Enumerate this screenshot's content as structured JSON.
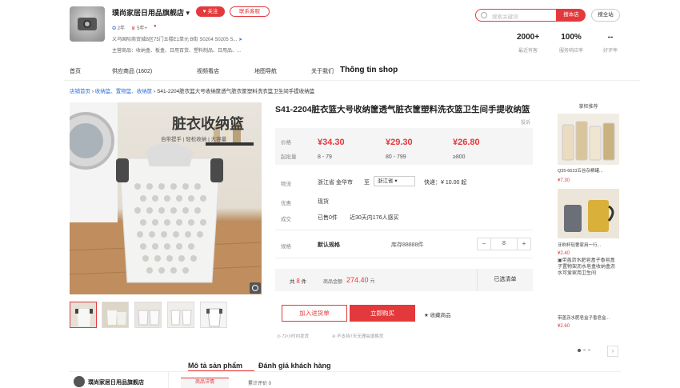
{
  "shop": {
    "name": "璞尚家居日用品旗舰店",
    "arrow": "▾",
    "follow_label": "♥ 关注",
    "contact_label": "联系客服",
    "badges": [
      "2年",
      "5年+",
      ""
    ],
    "address": "义乌国际商贸城B区75门五楼E1单元 B街 S0204 S0205 S...",
    "main_products": "主营商品：收纳盒、板盒、日用百货、塑料制品、日用品、..."
  },
  "search": {
    "placeholder": "搜索关键词",
    "search_shop_label": "搜本店",
    "search_all_label": "搜全站"
  },
  "stats": [
    {
      "value": "2000+",
      "label": "最近有客"
    },
    {
      "value": "100%",
      "label": "服务响应率"
    },
    {
      "value": "--",
      "label": "好评率"
    }
  ],
  "nav": {
    "items": [
      "首页",
      "供应商品 (1602)",
      "视频看店",
      "地图导航",
      "关于我们"
    ],
    "shop_info": "Thông tin shop"
  },
  "breadcrumb": {
    "home": "店铺首页",
    "sep": "›",
    "category": "收纳篮、置物篮、收纳筐",
    "current": "S41-2204脏衣篮大号收纳筐透气脏衣筐塑料洗衣篮卫生间手提收纳篮"
  },
  "gallery": {
    "banner_title": "脏衣收纳篮",
    "banner_sub": "自带提手 | 轻松收纳 | 大容量"
  },
  "product": {
    "title": "S41-2204脏衣篮大号收纳筐透气脏衣筐塑料洗衣篮卫生间手提收纳篮",
    "report": "投诉",
    "price_label": "价格",
    "moq_label": "起批量",
    "tiers": [
      {
        "price": "¥34.30",
        "qty": "8 - 79"
      },
      {
        "price": "¥29.30",
        "qty": "80 - 799"
      },
      {
        "price": "¥26.80",
        "qty": "≥800"
      }
    ],
    "shipping_label": "物流",
    "ship_from": "浙江省 金华市",
    "ship_to_word": "至",
    "ship_to": "浙江省",
    "ship_fee": "快递：¥ 10.00 起",
    "service_label": "优惠",
    "service_value": "现货",
    "deal_label": "成交",
    "deal_value_1": "已售0件",
    "deal_value_2": "近30天内176人感买",
    "spec_label": "规格",
    "spec_value": "默认规格",
    "stock": "库存88888件",
    "quantity": "8",
    "minus": "−",
    "plus": "+",
    "total_pre": "共",
    "total_count": "8",
    "total_unit": "件",
    "amount_label": "商品金额",
    "amount": "274.40",
    "amount_unit": "元",
    "selected_label": "已选清单",
    "add_cart_label": "加入进货单",
    "buy_label": "立即购买",
    "fav_label": "★ 收藏商品",
    "guarantee_1": "72小时内发货",
    "guarantee_2": "不支持7天无理由退换货"
  },
  "sidebar": {
    "title": "掌柜推荐",
    "items": [
      {
        "name": "Q35-6623五谷杂粮罐...",
        "price": "¥7.30"
      },
      {
        "name": "牙刷杯轻奢家用一行...",
        "price": "¥2.40"
      },
      {
        "name": "带盖沥水肥皂盒子香皂盒子置物架沥水皂盒收纳盒沥水可爱家用卫生间",
        "price": "¥2.60",
        "caption": "带盖沥水肥皂盒子香皂盒..."
      }
    ],
    "prev": "‹",
    "next": "›"
  },
  "bottom": {
    "tab_desc": "Mô tả sản phẩm",
    "tab_review": "Đánh giá khách hàng",
    "shop_name": "璞尚家居日用品旗舰店",
    "detail_tab": "商品详情",
    "review_tab": "累计评价 0"
  },
  "colors": {
    "accent": "#e4393c",
    "link": "#2f6fd6"
  }
}
